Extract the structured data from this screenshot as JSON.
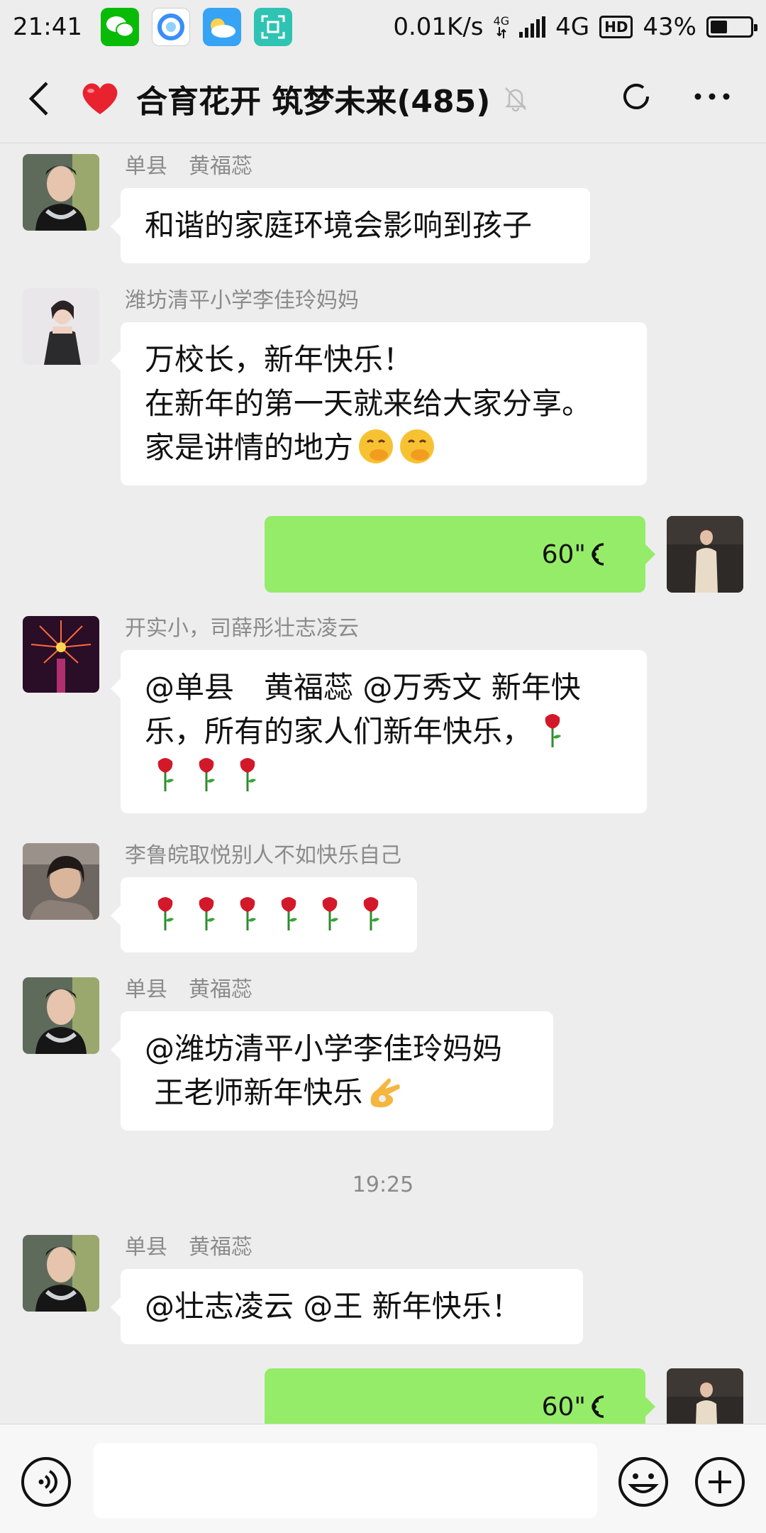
{
  "status_bar": {
    "time": "21:41",
    "speed": "0.01K/s",
    "net_small": "4G",
    "network": "4G",
    "hd": "HD",
    "battery": "43%",
    "battery_level": 0.43
  },
  "header": {
    "title": "合育花开 筑梦未来(485)"
  },
  "messages": [
    {
      "sender": "单县　黄福蕊",
      "text": "和谐的家庭环境会影响到孩子"
    },
    {
      "sender": "潍坊清平小学李佳玲妈妈",
      "lines": [
        "万校长，新年快乐！",
        "在新年的第一天就来给大家分享。",
        "家是讲情的地方"
      ]
    },
    {
      "duration": "60\""
    },
    {
      "sender": "开实小，司薛彤壮志凌云",
      "lines": [
        "@单县　黄福蕊 @万秀文  新年快",
        "乐，所有的家人们新年快乐，"
      ]
    },
    {
      "sender": "李鲁皖取悦别人不如快乐自己"
    },
    {
      "sender": "单县　黄福蕊",
      "lines": [
        "@潍坊清平小学李佳玲妈妈",
        " 王老师新年快乐"
      ]
    },
    {
      "sender": "单县　黄福蕊",
      "text": "@壮志凌云  @王  新年快乐！"
    },
    {
      "duration": "60\""
    }
  ],
  "timestamp": "19:25",
  "colors": {
    "background": "#ededed",
    "bubble_self": "#95ec69",
    "bubble_other": "#ffffff",
    "sender_name": "#8b8b8b"
  },
  "input_bar": {
    "value": ""
  }
}
